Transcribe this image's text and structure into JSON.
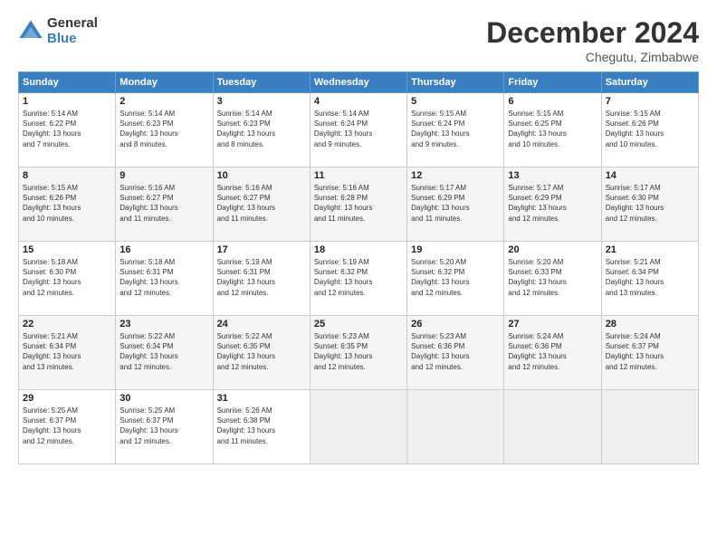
{
  "header": {
    "logo_general": "General",
    "logo_blue": "Blue",
    "month_title": "December 2024",
    "location": "Chegutu, Zimbabwe"
  },
  "days_of_week": [
    "Sunday",
    "Monday",
    "Tuesday",
    "Wednesday",
    "Thursday",
    "Friday",
    "Saturday"
  ],
  "weeks": [
    [
      {
        "day": "1",
        "sunrise": "5:14 AM",
        "sunset": "6:22 PM",
        "daylight": "13 hours and 7 minutes."
      },
      {
        "day": "2",
        "sunrise": "5:14 AM",
        "sunset": "6:23 PM",
        "daylight": "13 hours and 8 minutes."
      },
      {
        "day": "3",
        "sunrise": "5:14 AM",
        "sunset": "6:23 PM",
        "daylight": "13 hours and 8 minutes."
      },
      {
        "day": "4",
        "sunrise": "5:14 AM",
        "sunset": "6:24 PM",
        "daylight": "13 hours and 9 minutes."
      },
      {
        "day": "5",
        "sunrise": "5:15 AM",
        "sunset": "6:24 PM",
        "daylight": "13 hours and 9 minutes."
      },
      {
        "day": "6",
        "sunrise": "5:15 AM",
        "sunset": "6:25 PM",
        "daylight": "13 hours and 10 minutes."
      },
      {
        "day": "7",
        "sunrise": "5:15 AM",
        "sunset": "6:26 PM",
        "daylight": "13 hours and 10 minutes."
      }
    ],
    [
      {
        "day": "8",
        "sunrise": "5:15 AM",
        "sunset": "6:26 PM",
        "daylight": "13 hours and 10 minutes."
      },
      {
        "day": "9",
        "sunrise": "5:16 AM",
        "sunset": "6:27 PM",
        "daylight": "13 hours and 11 minutes."
      },
      {
        "day": "10",
        "sunrise": "5:16 AM",
        "sunset": "6:27 PM",
        "daylight": "13 hours and 11 minutes."
      },
      {
        "day": "11",
        "sunrise": "5:16 AM",
        "sunset": "6:28 PM",
        "daylight": "13 hours and 11 minutes."
      },
      {
        "day": "12",
        "sunrise": "5:17 AM",
        "sunset": "6:29 PM",
        "daylight": "13 hours and 11 minutes."
      },
      {
        "day": "13",
        "sunrise": "5:17 AM",
        "sunset": "6:29 PM",
        "daylight": "13 hours and 12 minutes."
      },
      {
        "day": "14",
        "sunrise": "5:17 AM",
        "sunset": "6:30 PM",
        "daylight": "13 hours and 12 minutes."
      }
    ],
    [
      {
        "day": "15",
        "sunrise": "5:18 AM",
        "sunset": "6:30 PM",
        "daylight": "13 hours and 12 minutes."
      },
      {
        "day": "16",
        "sunrise": "5:18 AM",
        "sunset": "6:31 PM",
        "daylight": "13 hours and 12 minutes."
      },
      {
        "day": "17",
        "sunrise": "5:19 AM",
        "sunset": "6:31 PM",
        "daylight": "13 hours and 12 minutes."
      },
      {
        "day": "18",
        "sunrise": "5:19 AM",
        "sunset": "6:32 PM",
        "daylight": "13 hours and 12 minutes."
      },
      {
        "day": "19",
        "sunrise": "5:20 AM",
        "sunset": "6:32 PM",
        "daylight": "13 hours and 12 minutes."
      },
      {
        "day": "20",
        "sunrise": "5:20 AM",
        "sunset": "6:33 PM",
        "daylight": "13 hours and 12 minutes."
      },
      {
        "day": "21",
        "sunrise": "5:21 AM",
        "sunset": "6:34 PM",
        "daylight": "13 hours and 13 minutes."
      }
    ],
    [
      {
        "day": "22",
        "sunrise": "5:21 AM",
        "sunset": "6:34 PM",
        "daylight": "13 hours and 13 minutes."
      },
      {
        "day": "23",
        "sunrise": "5:22 AM",
        "sunset": "6:34 PM",
        "daylight": "13 hours and 12 minutes."
      },
      {
        "day": "24",
        "sunrise": "5:22 AM",
        "sunset": "6:35 PM",
        "daylight": "13 hours and 12 minutes."
      },
      {
        "day": "25",
        "sunrise": "5:23 AM",
        "sunset": "6:35 PM",
        "daylight": "13 hours and 12 minutes."
      },
      {
        "day": "26",
        "sunrise": "5:23 AM",
        "sunset": "6:36 PM",
        "daylight": "13 hours and 12 minutes."
      },
      {
        "day": "27",
        "sunrise": "5:24 AM",
        "sunset": "6:36 PM",
        "daylight": "13 hours and 12 minutes."
      },
      {
        "day": "28",
        "sunrise": "5:24 AM",
        "sunset": "6:37 PM",
        "daylight": "13 hours and 12 minutes."
      }
    ],
    [
      {
        "day": "29",
        "sunrise": "5:25 AM",
        "sunset": "6:37 PM",
        "daylight": "13 hours and 12 minutes."
      },
      {
        "day": "30",
        "sunrise": "5:25 AM",
        "sunset": "6:37 PM",
        "daylight": "13 hours and 12 minutes."
      },
      {
        "day": "31",
        "sunrise": "5:26 AM",
        "sunset": "6:38 PM",
        "daylight": "13 hours and 11 minutes."
      },
      null,
      null,
      null,
      null
    ]
  ]
}
